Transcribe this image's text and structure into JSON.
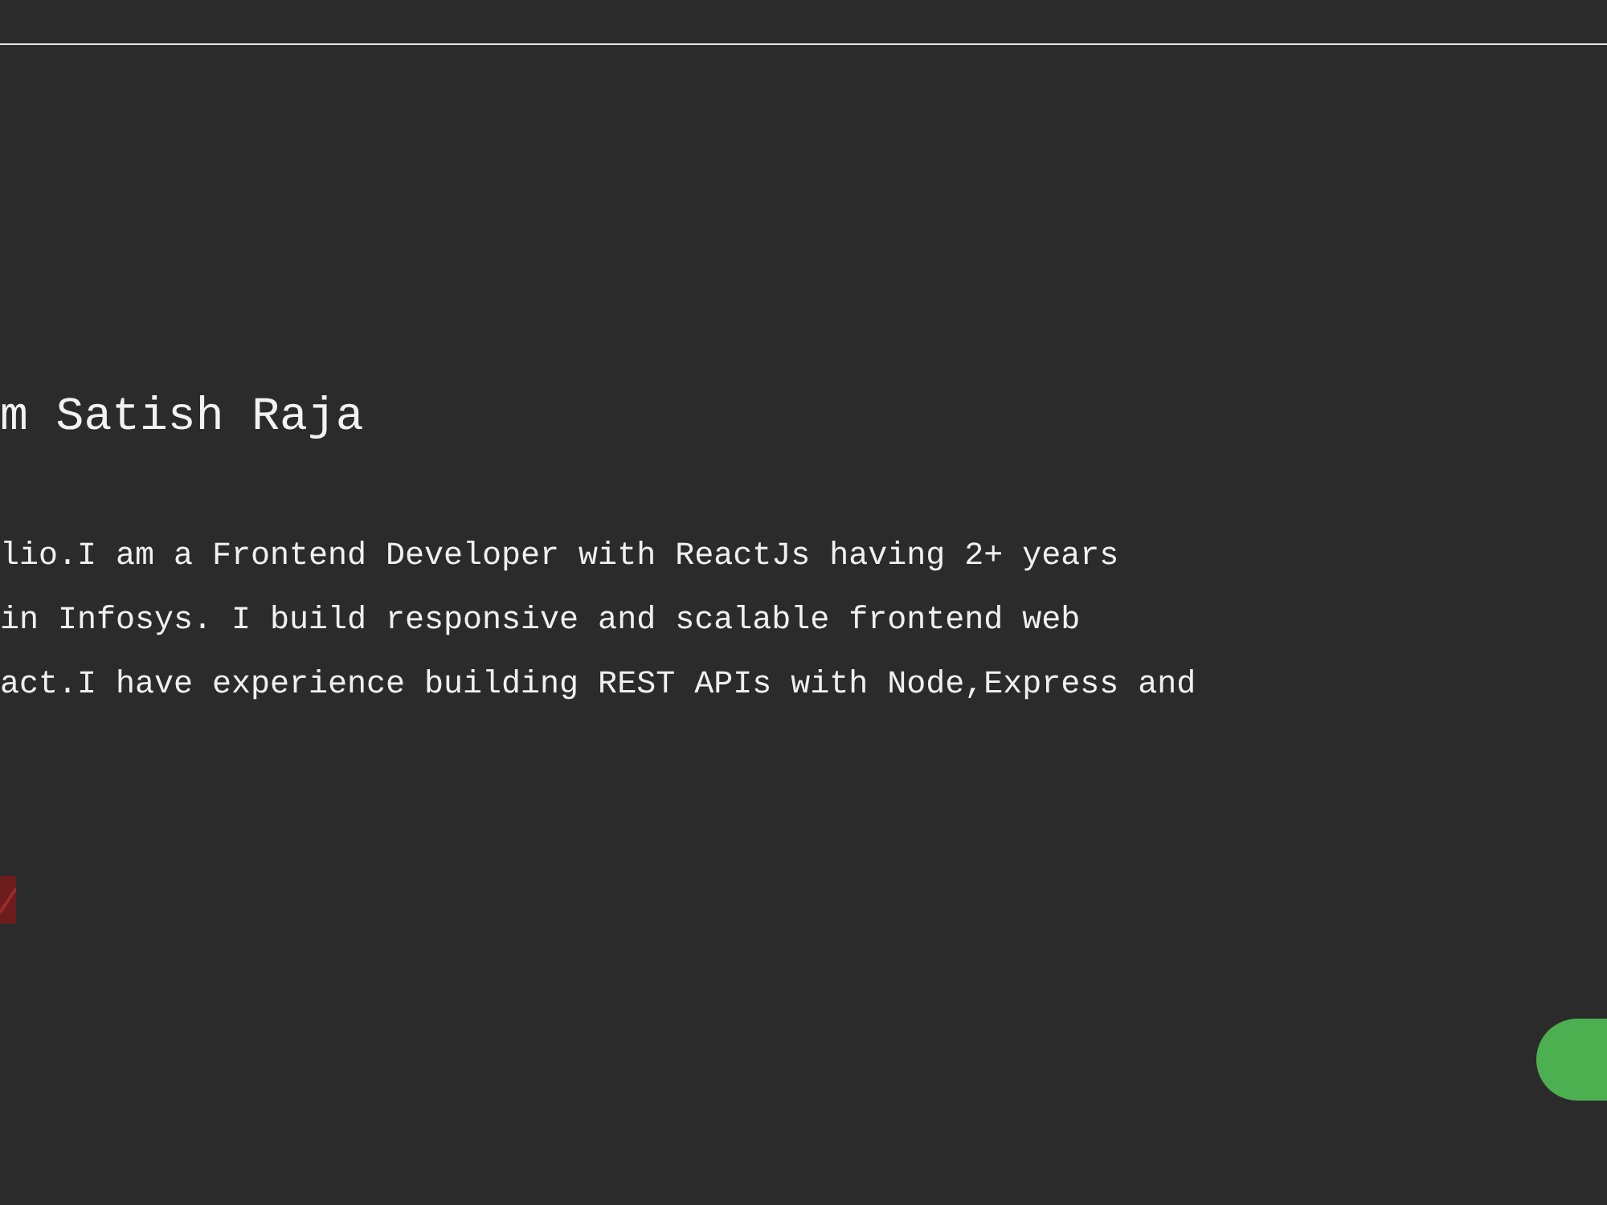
{
  "hero": {
    "heading": "m Satish Raja",
    "intro_lines": [
      "lio.I am a Frontend Developer with ReactJs having 2+ years",
      "in Infosys. I build responsive and scalable frontend web",
      "act.I have experience building REST APIs with Node,Express and"
    ]
  }
}
